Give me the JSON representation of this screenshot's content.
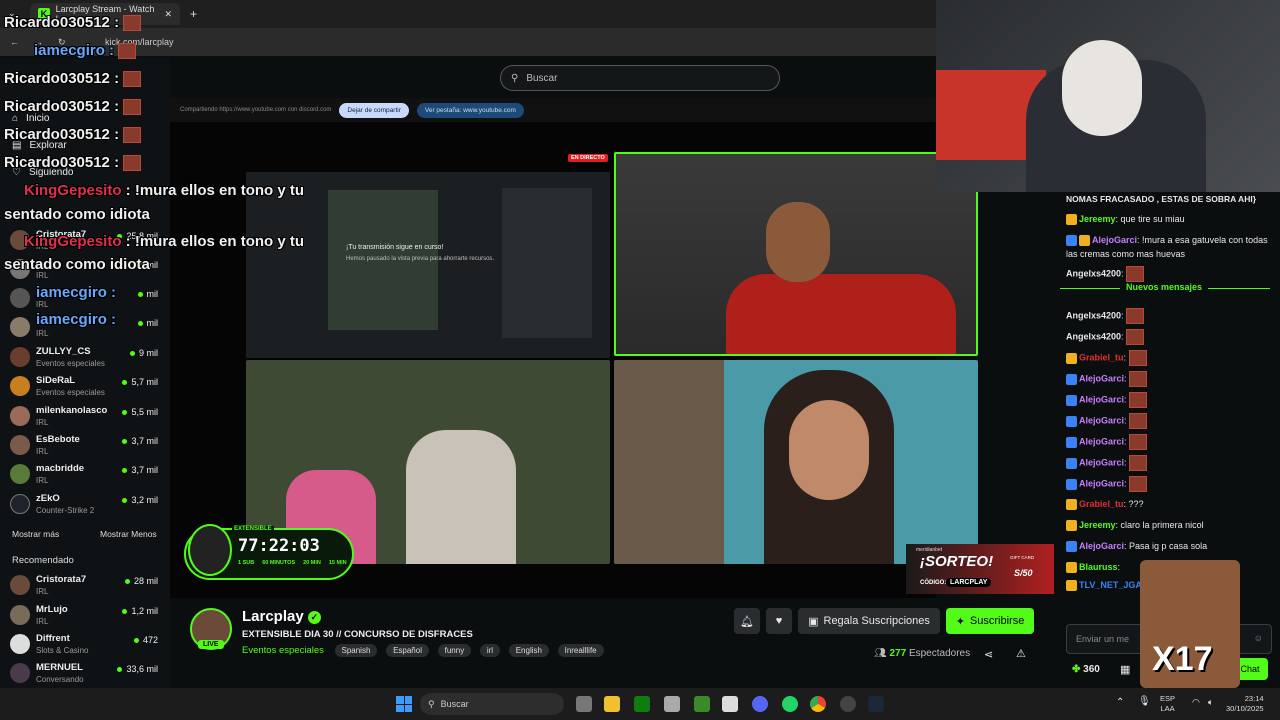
{
  "browser": {
    "tab_title": "Larcplay Stream - Watch L",
    "address": "kick.com/larcplay"
  },
  "search": {
    "placeholder": "Buscar"
  },
  "sidebar": {
    "nav": [
      {
        "label": "Inicio"
      },
      {
        "label": "Explorar"
      },
      {
        "label": "Siguiendo"
      }
    ],
    "channels": [
      {
        "name": "Cristorata7",
        "category": "IRL",
        "viewers": "25,8 mil"
      },
      {
        "name": "",
        "category": "IRL",
        "viewers": "mil"
      },
      {
        "name": "",
        "category": "IRL",
        "viewers": "mil"
      },
      {
        "name": "",
        "category": "IRL",
        "viewers": "mil"
      },
      {
        "name": "ZULLYY_CS",
        "category": "Eventos especiales",
        "viewers": "9 mil"
      },
      {
        "name": "SiDeRaL",
        "category": "Eventos especiales",
        "viewers": "5,7 mil"
      },
      {
        "name": "milenkanolasco",
        "category": "IRL",
        "viewers": "5,5 mil"
      },
      {
        "name": "EsBebote",
        "category": "IRL",
        "viewers": "3,7 mil"
      },
      {
        "name": "macbridde",
        "category": "IRL",
        "viewers": "3,7 mil"
      },
      {
        "name": "zEkO",
        "category": "Counter-Strike 2",
        "viewers": "3,2 mil"
      }
    ],
    "show_more": "Mostrar más",
    "show_less": "Mostrar Menos",
    "recommended_title": "Recomendado",
    "recommended": [
      {
        "name": "Cristorata7",
        "category": "IRL",
        "viewers": "28 mil"
      },
      {
        "name": "MrLujo",
        "category": "IRL",
        "viewers": "1,2 mil"
      },
      {
        "name": "Diffrent",
        "category": "Slots & Casino",
        "viewers": "472"
      },
      {
        "name": "MERNUEL",
        "category": "Conversando",
        "viewers": "33,6 mil"
      }
    ]
  },
  "player": {
    "share_text": "Compartiendo https://www.youtube.com con discord.com",
    "stop_share": "Dejar de compartir",
    "view_tab": "Ver pestaña: www.youtube.com",
    "live_badge": "EN DIRECTO",
    "preview_title": "¡Tu transmisión sigue en curso!",
    "preview_sub": "Hemos pausado la vista previa para ahorrarte recursos.",
    "timer_label": "EXTENSIBLE",
    "timer": "77:22:03",
    "timer_sub1": "1 SUB",
    "timer_sub1_val": "60 MINUTOS",
    "timer_sub2_val": "20 MIN",
    "timer_sub3_val": "15 MIN",
    "raffle_brand": "meridianbet",
    "raffle_title": "¡SORTEO!",
    "raffle_code_label": "CÓDIGO:",
    "raffle_code": "LARCPLAY",
    "gift_card": "GIFT CARD",
    "gift_value": "S/50"
  },
  "stream": {
    "channel": "Larcplay",
    "title": "EXTENSIBLE DIA 30 // CONCURSO DE DISFRACES",
    "category": "Eventos especiales",
    "tags": [
      "Spanish",
      "Español",
      "funny",
      "irl",
      "English",
      "Inrealllife"
    ],
    "live": "LIVE",
    "gift_subs": "Regala Suscripciones",
    "subscribe": "Suscribirse",
    "viewers_count": "277",
    "viewers_label": "Espectadores"
  },
  "overlay": {
    "lines": [
      {
        "user": "Ricardo030512",
        "text": " :"
      },
      {
        "user": "iamecgiro",
        "text": " :"
      },
      {
        "user": "Ricardo030512",
        "text": " :"
      },
      {
        "user": "Ricardo030512",
        "text": " :"
      },
      {
        "user": "Ricardo030512",
        "text": " :"
      },
      {
        "user": "Ricardo030512",
        "text": " :"
      }
    ],
    "king1_user": "KingGepesito",
    "king1_text": " : !mura ellos en tono y tu",
    "king1_text2": "sentado como idiota",
    "king2_user": "KingGepesito",
    "king2_text": " : !mura ellos en tono y tu",
    "king2_text2": "sentado como idiota",
    "iam1": "iamecgiro",
    "iam2": "iamecgiro",
    "iam_sep": " :"
  },
  "chat": {
    "top_text": "NOMAS FRACASADO , ESTAS DE SOBRA AHI}",
    "new_messages": "Nuevos mensajes",
    "messages": [
      {
        "user": "Jereemy",
        "color": "#53fc18",
        "text": ": que tire su miau"
      },
      {
        "user": "AlejoGarci",
        "color": "#c77dff",
        "text": ": !mura a esa gatuvela con todas las cremas como mas huevas"
      },
      {
        "user": "Angelxs4200",
        "color": "#eeeeee",
        "text": ":"
      },
      {
        "user": "Angelxs4200",
        "color": "#eeeeee",
        "text": ":"
      },
      {
        "user": "Angelxs4200",
        "color": "#eeeeee",
        "text": ":"
      },
      {
        "user": "Grabiel_tu",
        "color": "#e03030",
        "text": ":"
      },
      {
        "user": "AlejoGarci",
        "color": "#c77dff",
        "text": ":"
      },
      {
        "user": "AlejoGarci",
        "color": "#c77dff",
        "text": ":"
      },
      {
        "user": "AlejoGarci",
        "color": "#c77dff",
        "text": ":"
      },
      {
        "user": "AlejoGarci",
        "color": "#c77dff",
        "text": ":"
      },
      {
        "user": "AlejoGarci",
        "color": "#c77dff",
        "text": ":"
      },
      {
        "user": "AlejoGarci",
        "color": "#c77dff",
        "text": ":"
      },
      {
        "user": "Grabiel_tu",
        "color": "#e03030",
        "text": ": ???"
      },
      {
        "user": "Jereemy",
        "color": "#53fc18",
        "text": ": claro la primera nicol"
      },
      {
        "user": "AlejoGarci",
        "color": "#c77dff",
        "text": ": Pasa ig p casa sola"
      },
      {
        "user": "Blauruss",
        "color": "#53fc18",
        "text": ":"
      },
      {
        "user": "TLV_NET_JGA",
        "color": "#3b82f6",
        "text": ""
      }
    ],
    "input_placeholder": "Enviar un me",
    "points": "360",
    "chat_button": "Chat",
    "combo": "X17"
  },
  "taskbar": {
    "search": "Buscar",
    "lang": "ESP",
    "lang2": "LAA",
    "time": "23:14",
    "date": "30/10/2025"
  }
}
